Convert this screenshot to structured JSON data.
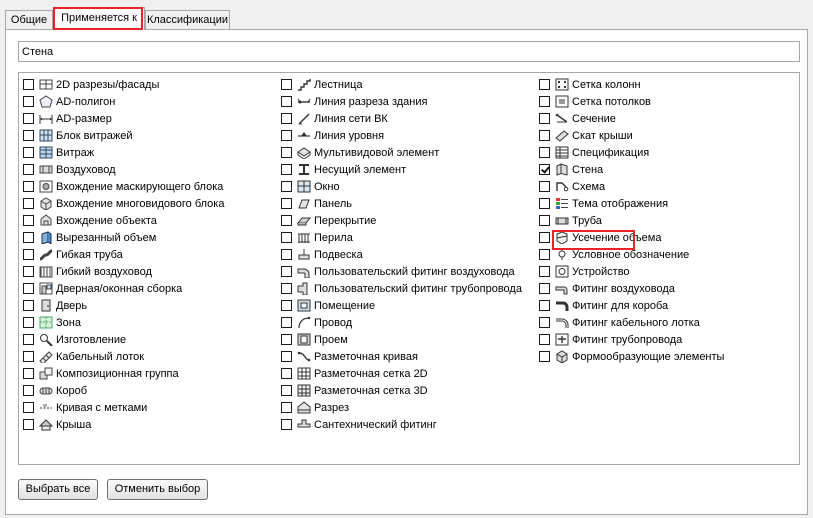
{
  "tabs": [
    {
      "label": "Общие"
    },
    {
      "label": "Применяется к"
    },
    {
      "label": "Классификации"
    }
  ],
  "filter": {
    "value": "Стена"
  },
  "columns": [
    [
      {
        "label": "2D разрезы/фасады",
        "icon": "section-elevation-icon",
        "checked": false
      },
      {
        "label": "AD-полигон",
        "icon": "polygon-icon",
        "checked": false
      },
      {
        "label": "AD-размер",
        "icon": "dimension-icon",
        "checked": false
      },
      {
        "label": "Блок витражей",
        "icon": "curtain-block-icon",
        "checked": false
      },
      {
        "label": "Витраж",
        "icon": "curtain-wall-icon",
        "checked": false
      },
      {
        "label": "Воздуховод",
        "icon": "duct-icon",
        "checked": false
      },
      {
        "label": "Вхождение маскирующего блока",
        "icon": "mask-block-icon",
        "checked": false
      },
      {
        "label": "Вхождение многовидового блока",
        "icon": "multiview-block-icon",
        "checked": false
      },
      {
        "label": "Вхождение объекта",
        "icon": "object-reference-icon",
        "checked": false
      },
      {
        "label": "Вырезанный объем",
        "icon": "cut-volume-icon",
        "checked": false
      },
      {
        "label": "Гибкая труба",
        "icon": "flex-pipe-icon",
        "checked": false
      },
      {
        "label": "Гибкий воздуховод",
        "icon": "flex-duct-icon",
        "checked": false
      },
      {
        "label": "Дверная/оконная сборка",
        "icon": "door-window-assembly-icon",
        "checked": false
      },
      {
        "label": "Дверь",
        "icon": "door-icon",
        "checked": false
      },
      {
        "label": "Зона",
        "icon": "zone-icon",
        "checked": false
      },
      {
        "label": "Изготовление",
        "icon": "fabrication-icon",
        "checked": false
      },
      {
        "label": "Кабельный лоток",
        "icon": "cable-tray-icon",
        "checked": false
      },
      {
        "label": "Композиционная группа",
        "icon": "composition-group-icon",
        "checked": false
      },
      {
        "label": "Короб",
        "icon": "conduit-icon",
        "checked": false
      },
      {
        "label": "Кривая с метками",
        "icon": "labeled-curve-icon",
        "checked": false
      },
      {
        "label": "Крыша",
        "icon": "roof-icon",
        "checked": false
      }
    ],
    [
      {
        "label": "Лестница",
        "icon": "stair-icon",
        "checked": false
      },
      {
        "label": "Линия разреза здания",
        "icon": "section-line-icon",
        "checked": false
      },
      {
        "label": "Линия сети ВК",
        "icon": "pipe-line-icon",
        "checked": false
      },
      {
        "label": "Линия уровня",
        "icon": "level-line-icon",
        "checked": false
      },
      {
        "label": "Мультивидовой элемент",
        "icon": "multiview-part-icon",
        "checked": false
      },
      {
        "label": "Несущий элемент",
        "icon": "structural-member-icon",
        "checked": false
      },
      {
        "label": "Окно",
        "icon": "window-icon",
        "checked": false
      },
      {
        "label": "Панель",
        "icon": "panel-icon",
        "checked": false
      },
      {
        "label": "Перекрытие",
        "icon": "slab-icon",
        "checked": false
      },
      {
        "label": "Перила",
        "icon": "railing-icon",
        "checked": false
      },
      {
        "label": "Подвеска",
        "icon": "hanger-icon",
        "checked": false
      },
      {
        "label": "Пользовательский фитинг воздуховода",
        "icon": "custom-duct-fitting-icon",
        "checked": false
      },
      {
        "label": "Пользовательский фитинг трубопровода",
        "icon": "custom-pipe-fitting-icon",
        "checked": false
      },
      {
        "label": "Помещение",
        "icon": "space-icon",
        "checked": false
      },
      {
        "label": "Провод",
        "icon": "wire-icon",
        "checked": false
      },
      {
        "label": "Проем",
        "icon": "opening-icon",
        "checked": false
      },
      {
        "label": "Разметочная кривая",
        "icon": "layout-curve-icon",
        "checked": false
      },
      {
        "label": "Разметочная сетка 2D",
        "icon": "layout-grid-2d-icon",
        "checked": false
      },
      {
        "label": "Разметочная сетка 3D",
        "icon": "layout-grid-3d-icon",
        "checked": false
      },
      {
        "label": "Разрез",
        "icon": "section-icon",
        "checked": false
      },
      {
        "label": "Сантехнический фитинг",
        "icon": "plumbing-fitting-icon",
        "checked": false
      }
    ],
    [
      {
        "label": "Сетка колонн",
        "icon": "column-grid-icon",
        "checked": false
      },
      {
        "label": "Сетка потолков",
        "icon": "ceiling-grid-icon",
        "checked": false
      },
      {
        "label": "Сечение",
        "icon": "section-cut-icon",
        "checked": false
      },
      {
        "label": "Скат крыши",
        "icon": "roof-slab-icon",
        "checked": false
      },
      {
        "label": "Спецификация",
        "icon": "schedule-icon",
        "checked": false
      },
      {
        "label": "Стена",
        "icon": "wall-icon",
        "checked": true
      },
      {
        "label": "Схема",
        "icon": "schematic-icon",
        "checked": false
      },
      {
        "label": "Тема отображения",
        "icon": "display-theme-icon",
        "checked": false
      },
      {
        "label": "Труба",
        "icon": "pipe-icon",
        "checked": false
      },
      {
        "label": "Усечение объема",
        "icon": "volume-clip-icon",
        "checked": false
      },
      {
        "label": "Условное обозначение",
        "icon": "symbol-icon",
        "checked": false
      },
      {
        "label": "Устройство",
        "icon": "device-icon",
        "checked": false
      },
      {
        "label": "Фитинг воздуховода",
        "icon": "duct-fitting-icon",
        "checked": false
      },
      {
        "label": "Фитинг для короба",
        "icon": "conduit-fitting-icon",
        "checked": false
      },
      {
        "label": "Фитинг кабельного лотка",
        "icon": "cable-tray-fitting-icon",
        "checked": false
      },
      {
        "label": "Фитинг трубопровода",
        "icon": "pipe-fitting-icon",
        "checked": false
      },
      {
        "label": "Формообразующие элементы",
        "icon": "mass-element-icon",
        "checked": false
      }
    ]
  ],
  "buttons": {
    "select_all": "Выбрать все",
    "clear_selection": "Отменить выбор"
  },
  "colors": {
    "highlight": "#e8232a",
    "border": "#a7a7a7"
  }
}
